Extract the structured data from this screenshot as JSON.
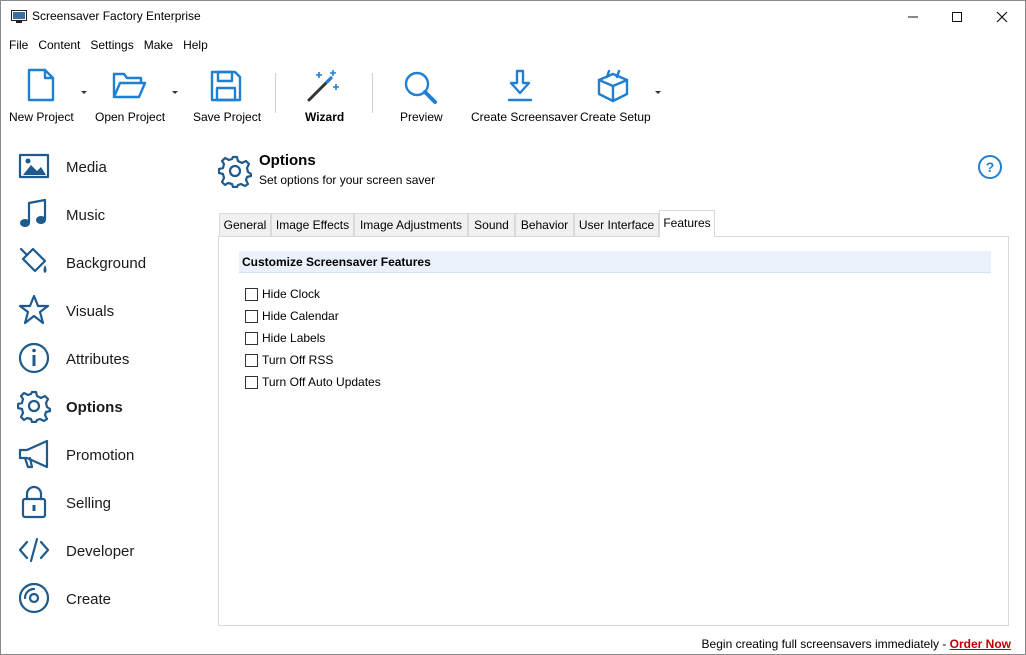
{
  "window": {
    "title": "Screensaver Factory Enterprise",
    "accent": "#1f7fd1"
  },
  "menu": [
    "File",
    "Content",
    "Settings",
    "Make",
    "Help"
  ],
  "toolbar": {
    "new_project": "New Project",
    "open_project": "Open Project",
    "save_project": "Save Project",
    "wizard": "Wizard",
    "preview": "Preview",
    "create_screensaver": "Create Screensaver",
    "create_setup": "Create Setup"
  },
  "sidebar": {
    "items": [
      {
        "label": "Media",
        "icon": "image-icon"
      },
      {
        "label": "Music",
        "icon": "music-note-icon"
      },
      {
        "label": "Background",
        "icon": "paint-bucket-icon"
      },
      {
        "label": "Visuals",
        "icon": "star-icon"
      },
      {
        "label": "Attributes",
        "icon": "info-icon"
      },
      {
        "label": "Options",
        "icon": "gear-icon",
        "active": true
      },
      {
        "label": "Promotion",
        "icon": "megaphone-icon"
      },
      {
        "label": "Selling",
        "icon": "lock-icon"
      },
      {
        "label": "Developer",
        "icon": "code-icon"
      },
      {
        "label": "Create",
        "icon": "disc-icon"
      }
    ]
  },
  "header": {
    "title": "Options",
    "subtitle": "Set options for your screen saver"
  },
  "tabs": [
    "General",
    "Image Effects",
    "Image Adjustments",
    "Sound",
    "Behavior",
    "User Interface",
    "Features"
  ],
  "active_tab": "Features",
  "features": {
    "group_title": "Customize Screensaver Features",
    "options": [
      {
        "label": "Hide Clock",
        "checked": false
      },
      {
        "label": "Hide Calendar",
        "checked": false
      },
      {
        "label": "Hide Labels",
        "checked": false
      },
      {
        "label": "Turn Off RSS",
        "checked": false
      },
      {
        "label": "Turn Off Auto Updates",
        "checked": false
      }
    ]
  },
  "footer": {
    "text": "Begin creating full screensavers immediately - ",
    "link": "Order Now"
  }
}
